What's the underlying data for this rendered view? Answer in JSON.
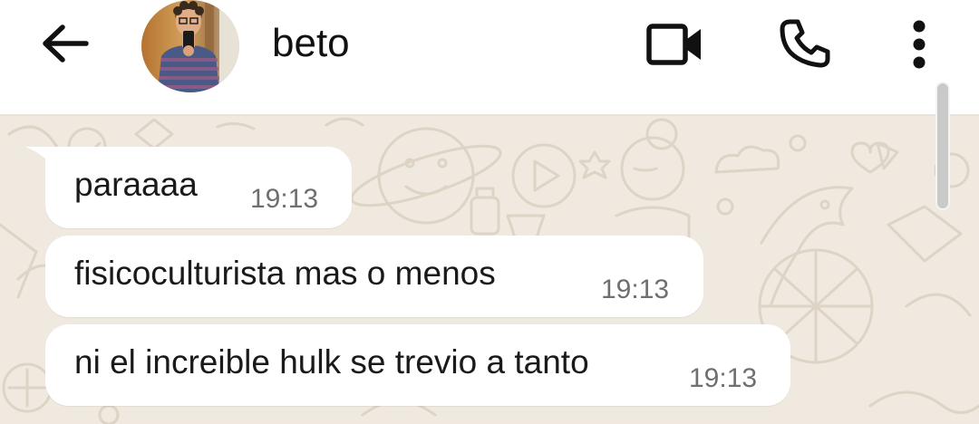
{
  "header": {
    "contact_name": "beto",
    "back_icon": "arrow-left-icon",
    "video_icon": "video-camera-icon",
    "call_icon": "phone-icon",
    "menu_icon": "more-vertical-icon"
  },
  "messages": [
    {
      "text": "paraaaa",
      "time": "19:13"
    },
    {
      "text": "fisicoculturista mas o menos",
      "time": "19:13"
    },
    {
      "text": "ni el increible hulk se trevio a tanto",
      "time": "19:13"
    }
  ],
  "colors": {
    "header_bg": "#ffffff",
    "chat_bg": "#efe9e0",
    "bubble_bg": "#ffffff",
    "time_text": "#6f6f6f"
  }
}
